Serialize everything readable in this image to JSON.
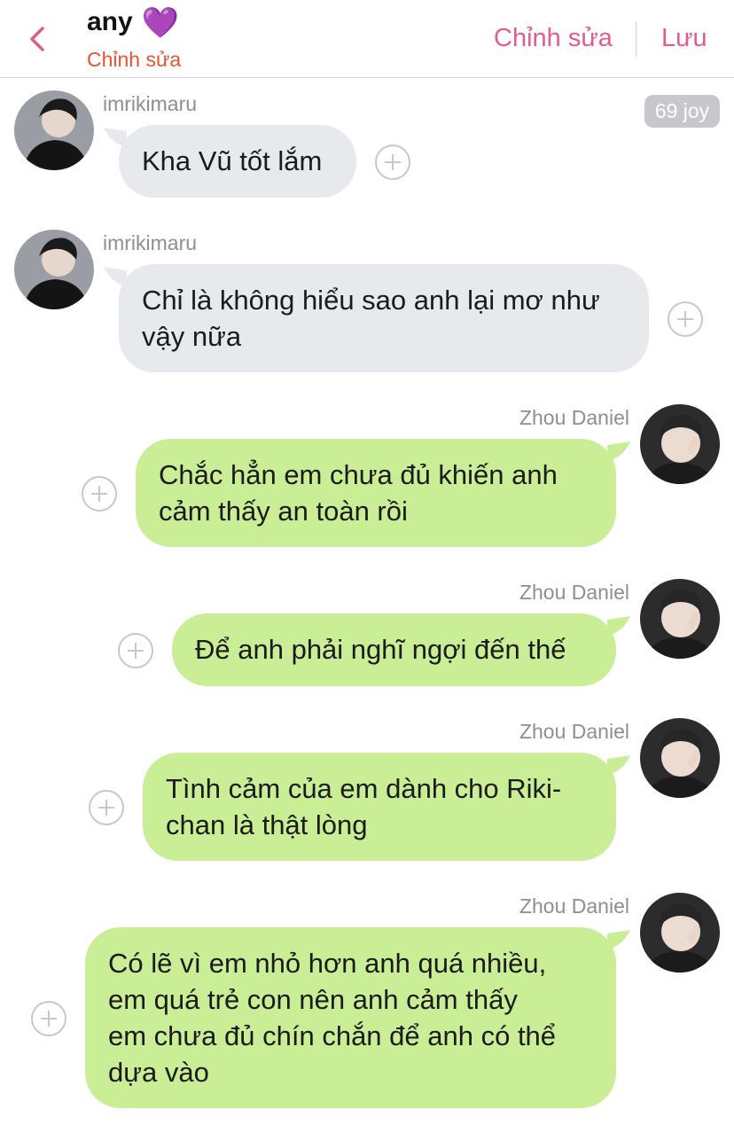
{
  "header": {
    "title": "any",
    "title_emoji": "💜",
    "subtitle": "Chỉnh sửa",
    "edit_label": "Chỉnh sửa",
    "save_label": "Lưu"
  },
  "badge": "69 joy",
  "messages": [
    {
      "direction": "incoming",
      "sender": "imrikimaru",
      "lines": [
        "Kha Vũ tốt lắm"
      ]
    },
    {
      "direction": "incoming",
      "sender": "imrikimaru",
      "lines": [
        "Chỉ là không hiểu sao anh lại mơ như",
        "vậy nữa"
      ]
    },
    {
      "direction": "outgoing",
      "sender": "Zhou Daniel",
      "lines": [
        "Chắc hẳn em chưa đủ khiến anh",
        "cảm thấy an toàn rồi"
      ]
    },
    {
      "direction": "outgoing",
      "sender": "Zhou Daniel",
      "lines": [
        "Để anh phải nghĩ ngợi đến thế"
      ]
    },
    {
      "direction": "outgoing",
      "sender": "Zhou Daniel",
      "lines": [
        "Tình cảm của em dành cho Riki-",
        "chan là thật lòng"
      ]
    },
    {
      "direction": "outgoing",
      "sender": "Zhou Daniel",
      "lines": [
        "Có lẽ vì em nhỏ hơn anh quá nhiều,",
        "em quá trẻ con nên anh cảm thấy",
        "em chưa đủ chín chắn để anh có thể",
        "dựa vào"
      ]
    }
  ],
  "colors": {
    "accent_pink": "#e05d8c",
    "subtitle_orange": "#e4542f",
    "incoming_bubble": "#e7e9ec",
    "outgoing_bubble": "#c9ee96"
  }
}
